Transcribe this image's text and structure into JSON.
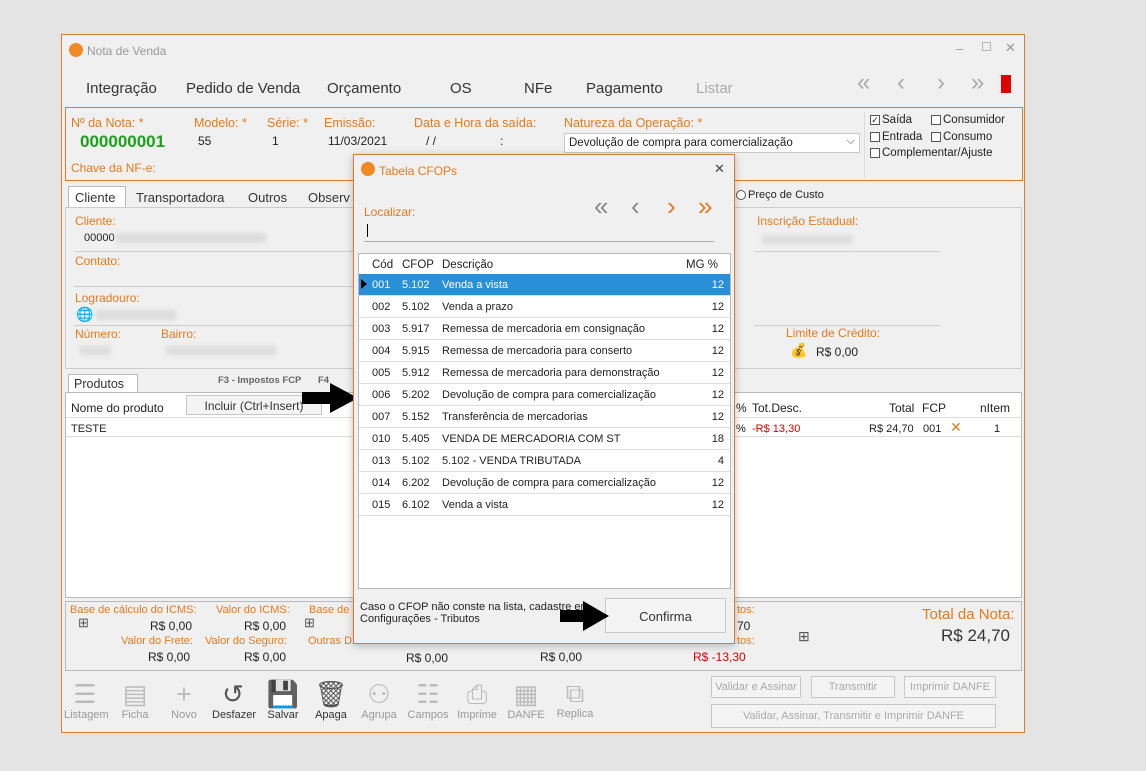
{
  "window": {
    "title": "Nota de Venda"
  },
  "menu": [
    "Integração",
    "Pedido de Venda",
    "Orçamento",
    "OS",
    "NFe",
    "Pagamento",
    "Listar"
  ],
  "header": {
    "nota_label": "Nº da Nota: *",
    "nota_value": "000000001",
    "modelo_label": "Modelo: *",
    "modelo_value": "55",
    "serie_label": "Série: *",
    "serie_value": "1",
    "emissao_label": "Emissão:",
    "emissao_value": "11/03/2021",
    "saida_label": "Data e Hora da saída:",
    "saida_value": "/ /",
    "saida_time": ":",
    "natureza_label": "Natureza da Operação: *",
    "natureza_value": "Devolução de compra para comercialização",
    "chave_label": "Chave da NF-e:",
    "checks": {
      "saida": "Saída",
      "consumidor": "Consumidor",
      "entrada": "Entrada",
      "consumo": "Consumo",
      "complementar": "Complementar/Ajuste"
    }
  },
  "tabs": {
    "cliente": "Cliente",
    "transportadora": "Transportadora",
    "outros": "Outros",
    "observ": "Observ"
  },
  "cliente": {
    "cliente_label": "Cliente:",
    "cliente_code": "00000",
    "contato_label": "Contato:",
    "logradouro_label": "Logradouro:",
    "numero_label": "Número:",
    "bairro_label": "Bairro:",
    "ie_label": "Inscrição Estadual:",
    "limite_label": "Limite de Crédito:",
    "limite_value": "R$ 0,00",
    "preco_custo": "Preço de Custo"
  },
  "produtos": {
    "tab": "Produtos",
    "hint_f3": "F3 - Impostos FCP",
    "hint_f4": "F4",
    "col_nome": "Nome do produto",
    "incluir": "Incluir (Ctrl+Insert)",
    "col_pct": "%",
    "col_totdesc": "Tot.Desc.",
    "col_total": "Total",
    "col_fcp": "FCP",
    "col_nitem": "nItem",
    "row": {
      "nome": "TESTE",
      "pct": "%",
      "totdesc": "-R$ 13,30",
      "total": "R$ 24,70",
      "fcp": "001",
      "nitem": "1"
    }
  },
  "totais": {
    "base_icms_label": "Base de cálculo do ICMS:",
    "base_icms": "R$ 0,00",
    "valor_icms_label": "Valor do ICMS:",
    "valor_icms": "R$ 0,00",
    "base_label": "Base de",
    "frete_label": "Valor do Frete:",
    "frete": "R$ 0,00",
    "seguro_label": "Valor do Seguro:",
    "seguro": "R$ 0,00",
    "outras_label": "Outras D",
    "v1": "R$ 0,00",
    "v2": "R$ 0,00",
    "tos1": "tos:",
    "tos1_val": "70",
    "tos2": "tos:",
    "tos2_val": "R$ -13,30",
    "total_nota_label": "Total da Nota:",
    "total_nota": "R$ 24,70"
  },
  "toolbar": [
    "Listagem",
    "Ficha",
    "Novo",
    "Desfazer",
    "Salvar",
    "Apaga",
    "Agrupa",
    "Campos",
    "Imprime",
    "DANFE",
    "Replica"
  ],
  "actions": {
    "validar_assinar": "Validar e Assinar",
    "transmitir": "Transmitir",
    "imprimir_danfe": "Imprimir DANFE",
    "tudo": "Validar, Assinar, Transmitir e Imprimir DANFE"
  },
  "dialog": {
    "title": "Tabela CFOPs",
    "localizar": "Localizar:",
    "cols": {
      "cod": "Cód",
      "cfop": "CFOP",
      "desc": "Descrição",
      "mg": "MG %"
    },
    "rows": [
      {
        "cod": "001",
        "cfop": "5.102",
        "desc": "Venda a vista",
        "mg": "12"
      },
      {
        "cod": "002",
        "cfop": "5.102",
        "desc": "Venda a prazo",
        "mg": "12"
      },
      {
        "cod": "003",
        "cfop": "5.917",
        "desc": "Remessa de mercadoria em consignação",
        "mg": "12"
      },
      {
        "cod": "004",
        "cfop": "5.915",
        "desc": "Remessa de mercadoria para conserto",
        "mg": "12"
      },
      {
        "cod": "005",
        "cfop": "5.912",
        "desc": "Remessa de mercadoria para demonstração",
        "mg": "12"
      },
      {
        "cod": "006",
        "cfop": "5.202",
        "desc": "Devolução de compra para comercialização",
        "mg": "12"
      },
      {
        "cod": "007",
        "cfop": "5.152",
        "desc": "Transferência de mercadorias",
        "mg": "12"
      },
      {
        "cod": "010",
        "cfop": "5.405",
        "desc": "VENDA DE MERCADORIA COM ST",
        "mg": "18"
      },
      {
        "cod": "013",
        "cfop": "5.102",
        "desc": "5.102 - VENDA TRIBUTADA",
        "mg": "4"
      },
      {
        "cod": "014",
        "cfop": "6.202",
        "desc": "Devolução de compra para comercialização",
        "mg": "12"
      },
      {
        "cod": "015",
        "cfop": "6.102",
        "desc": "Venda a vista",
        "mg": "12"
      }
    ],
    "footer_line1": "Caso o CFOP não conste na lista, cadastre em",
    "footer_line2": "Configurações - Tributos",
    "confirma": "Confirma"
  }
}
